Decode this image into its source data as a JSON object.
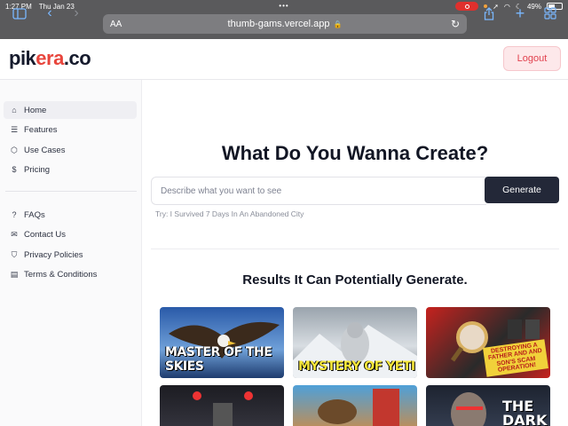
{
  "status_bar": {
    "time": "1:27 PM",
    "date": "Thu Jan 23",
    "battery": "49%"
  },
  "browser": {
    "text_size_label": "AA",
    "url": "thumb-gams.vercel.app"
  },
  "header": {
    "logo_main": "pik",
    "logo_accent": "era",
    "logo_suffix": ".co",
    "logout_label": "Logout"
  },
  "sidebar": {
    "primary": [
      {
        "label": "Home",
        "icon": "home-icon"
      },
      {
        "label": "Features",
        "icon": "list-icon"
      },
      {
        "label": "Use Cases",
        "icon": "box-icon"
      },
      {
        "label": "Pricing",
        "icon": "dollar-icon"
      }
    ],
    "secondary": [
      {
        "label": "FAQs",
        "icon": "help-icon"
      },
      {
        "label": "Contact Us",
        "icon": "mail-icon"
      },
      {
        "label": "Privacy Policies",
        "icon": "shield-icon"
      },
      {
        "label": "Terms & Conditions",
        "icon": "document-icon"
      }
    ]
  },
  "main": {
    "headline": "What Do You Wanna Create?",
    "prompt_placeholder": "Describe what you want to see",
    "generate_label": "Generate",
    "hint": "Try: I Survived 7 Days In An Abandoned City",
    "results_title": "Results It Can Potentially Generate.",
    "thumbnails": [
      {
        "caption": "MASTER OF THE SKIES"
      },
      {
        "caption": "MYSTERY OF YETI"
      },
      {
        "caption": "DESTROYING A FATHER AND AND SON'S SCAM OPERATION!"
      },
      {
        "caption": ""
      },
      {
        "caption": ""
      },
      {
        "caption": "THE DARK"
      }
    ]
  },
  "colors": {
    "accent": "#e8453c",
    "dark_button": "#232838",
    "logout_bg": "#fde8ea",
    "logout_text": "#e1414e"
  }
}
